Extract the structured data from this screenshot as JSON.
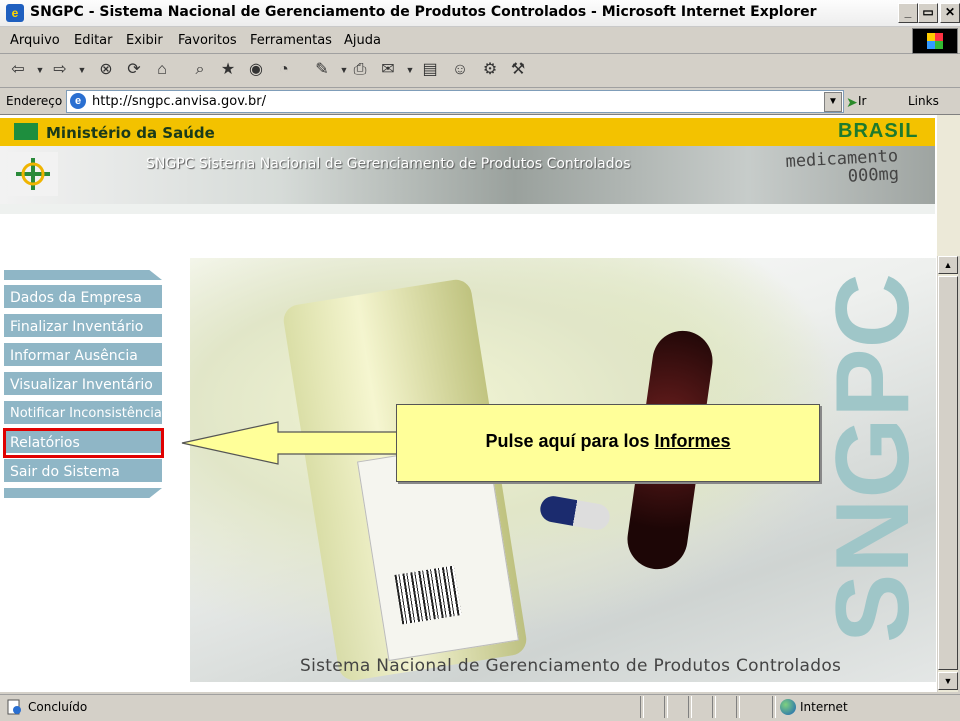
{
  "window": {
    "title": "SNGPC - Sistema Nacional de Gerenciamento de Produtos Controlados - Microsoft Internet Explorer",
    "minimize": "_",
    "maximize": "▭",
    "close": "✕"
  },
  "menu": {
    "items": [
      "Arquivo",
      "Editar",
      "Exibir",
      "Favoritos",
      "Ferramentas",
      "Ajuda"
    ]
  },
  "toolbar": {
    "icons": [
      "back-icon",
      "forward-icon",
      "stop-icon",
      "refresh-icon",
      "home-icon",
      "search-icon",
      "favorites-icon",
      "media-icon",
      "history-icon",
      "edit-icon",
      "print-icon",
      "mail-icon",
      "messenger-icon",
      "research-icon",
      "tools-icon"
    ]
  },
  "address": {
    "label": "Endereço",
    "url": "http://sngpc.anvisa.gov.br/",
    "go": "Ir",
    "links": "Links"
  },
  "site": {
    "ministry": "Ministério da Saúde",
    "brasil": "BRASIL",
    "header": "SNGPC Sistema Nacional de Gerenciamento de Produtos Controlados",
    "med_line1": "medicamento",
    "med_line2": "000mg",
    "vertical_brand": "SNGPC",
    "footer": "Sistema Nacional de Gerenciamento de Produtos Controlados"
  },
  "nav": {
    "items": [
      "Dados da Empresa",
      "Finalizar Inventário",
      "Informar Ausência",
      "Visualizar Inventário",
      "Notificar Inconsistência",
      "Relatórios",
      "Sair do Sistema"
    ],
    "highlighted": "Relatórios"
  },
  "callout": {
    "prefix": "Pulse aquí para los ",
    "link": "Informes"
  },
  "status": {
    "text": "Concluído",
    "zone": "Internet"
  },
  "colors": {
    "nav_bg": "#8fb6c6",
    "highlight": "#e00000",
    "callout_bg": "#ffff99",
    "ministry_bar": "#f3c200"
  }
}
